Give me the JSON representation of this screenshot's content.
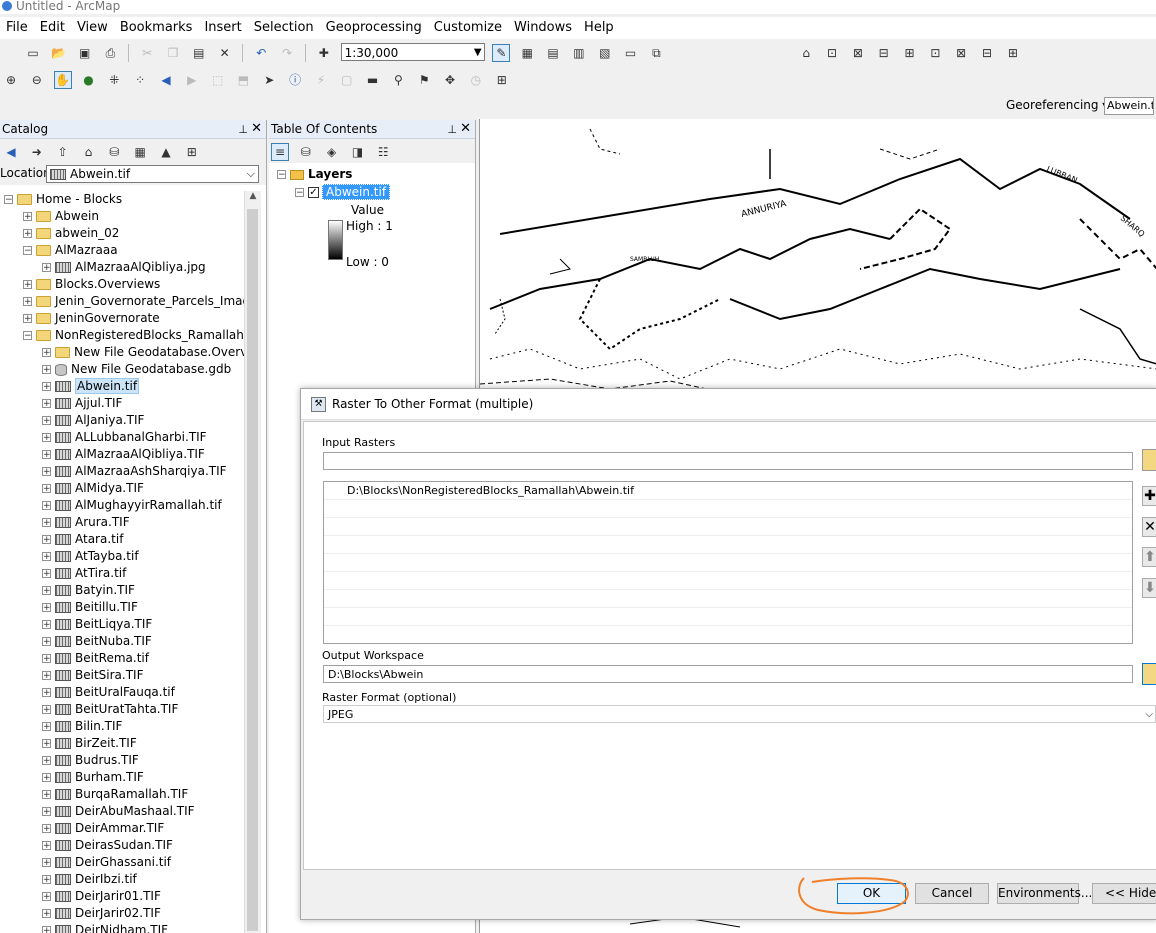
{
  "window": {
    "title": "Untitled - ArcMap"
  },
  "menu": [
    "File",
    "Edit",
    "View",
    "Bookmarks",
    "Insert",
    "Selection",
    "Geoprocessing",
    "Customize",
    "Windows",
    "Help"
  ],
  "toolbar": {
    "scale": "1:30,000"
  },
  "georef": {
    "label": "Georeferencing ▾",
    "layer": "Abwein.tif"
  },
  "catalog": {
    "title": "Catalog",
    "location_label": "Location:",
    "location_value": "Abwein.tif",
    "items": [
      {
        "label": "Home - Blocks",
        "type": "folder",
        "level": 0,
        "exp": "−"
      },
      {
        "label": "Abwein",
        "type": "folder",
        "level": 1,
        "exp": "+"
      },
      {
        "label": "abwein_02",
        "type": "folder",
        "level": 1,
        "exp": "+"
      },
      {
        "label": "AlMazraaa",
        "type": "folder",
        "level": 1,
        "exp": "−"
      },
      {
        "label": "AlMazraaAlQibliya.jpg",
        "type": "raster",
        "level": 2,
        "exp": "+"
      },
      {
        "label": "Blocks.Overviews",
        "type": "folder",
        "level": 1,
        "exp": "+"
      },
      {
        "label": "Jenin_Governorate_Parcels_Images",
        "type": "folder",
        "level": 1,
        "exp": "+"
      },
      {
        "label": "JeninGovernorate",
        "type": "folder",
        "level": 1,
        "exp": "+"
      },
      {
        "label": "NonRegisteredBlocks_Ramallah",
        "type": "folder",
        "level": 1,
        "exp": "−"
      },
      {
        "label": "New File Geodatabase.Overview",
        "type": "folder",
        "level": 2,
        "exp": "+"
      },
      {
        "label": "New File Geodatabase.gdb",
        "type": "gdb",
        "level": 2,
        "exp": "+"
      },
      {
        "label": "Abwein.tif",
        "type": "raster",
        "level": 2,
        "exp": "+",
        "selected": true
      },
      {
        "label": "Ajjul.TIF",
        "type": "raster",
        "level": 2,
        "exp": "+"
      },
      {
        "label": "AlJaniya.TIF",
        "type": "raster",
        "level": 2,
        "exp": "+"
      },
      {
        "label": "ALLubbanalGharbi.TIF",
        "type": "raster",
        "level": 2,
        "exp": "+"
      },
      {
        "label": "AlMazraaAlQibliya.TIF",
        "type": "raster",
        "level": 2,
        "exp": "+"
      },
      {
        "label": "AlMazraaAshSharqiya.TIF",
        "type": "raster",
        "level": 2,
        "exp": "+"
      },
      {
        "label": "AlMidya.TIF",
        "type": "raster",
        "level": 2,
        "exp": "+"
      },
      {
        "label": "AlMughayyirRamallah.tif",
        "type": "raster",
        "level": 2,
        "exp": "+"
      },
      {
        "label": "Arura.TIF",
        "type": "raster",
        "level": 2,
        "exp": "+"
      },
      {
        "label": "Atara.tif",
        "type": "raster",
        "level": 2,
        "exp": "+"
      },
      {
        "label": "AtTayba.tif",
        "type": "raster",
        "level": 2,
        "exp": "+"
      },
      {
        "label": "AtTira.tif",
        "type": "raster",
        "level": 2,
        "exp": "+"
      },
      {
        "label": "Batyin.TIF",
        "type": "raster",
        "level": 2,
        "exp": "+"
      },
      {
        "label": "Beitillu.TIF",
        "type": "raster",
        "level": 2,
        "exp": "+"
      },
      {
        "label": "BeitLiqya.TIF",
        "type": "raster",
        "level": 2,
        "exp": "+"
      },
      {
        "label": "BeitNuba.TIF",
        "type": "raster",
        "level": 2,
        "exp": "+"
      },
      {
        "label": "BeitRema.tif",
        "type": "raster",
        "level": 2,
        "exp": "+"
      },
      {
        "label": "BeitSira.TIF",
        "type": "raster",
        "level": 2,
        "exp": "+"
      },
      {
        "label": "BeitUralFauqa.tif",
        "type": "raster",
        "level": 2,
        "exp": "+"
      },
      {
        "label": "BeitUratTahta.TIF",
        "type": "raster",
        "level": 2,
        "exp": "+"
      },
      {
        "label": "Bilin.TIF",
        "type": "raster",
        "level": 2,
        "exp": "+"
      },
      {
        "label": "BirZeit.TIF",
        "type": "raster",
        "level": 2,
        "exp": "+"
      },
      {
        "label": "Budrus.TIF",
        "type": "raster",
        "level": 2,
        "exp": "+"
      },
      {
        "label": "Burham.TIF",
        "type": "raster",
        "level": 2,
        "exp": "+"
      },
      {
        "label": "BurqaRamallah.TIF",
        "type": "raster",
        "level": 2,
        "exp": "+"
      },
      {
        "label": "DeirAbuMashaal.TIF",
        "type": "raster",
        "level": 2,
        "exp": "+"
      },
      {
        "label": "DeirAmmar.TIF",
        "type": "raster",
        "level": 2,
        "exp": "+"
      },
      {
        "label": "DeirasSudan.TIF",
        "type": "raster",
        "level": 2,
        "exp": "+"
      },
      {
        "label": "DeirGhassani.tif",
        "type": "raster",
        "level": 2,
        "exp": "+"
      },
      {
        "label": "DeirIbzi.tif",
        "type": "raster",
        "level": 2,
        "exp": "+"
      },
      {
        "label": "DeirJarir01.TIF",
        "type": "raster",
        "level": 2,
        "exp": "+"
      },
      {
        "label": "DeirJarir02.TIF",
        "type": "raster",
        "level": 2,
        "exp": "+"
      },
      {
        "label": "DeirNidham.TIF",
        "type": "raster",
        "level": 2,
        "exp": "+"
      }
    ]
  },
  "toc": {
    "title": "Table Of Contents",
    "layers_label": "Layers",
    "layer_name": "Abwein.tif",
    "value_label": "Value",
    "high_label": "High : 1",
    "low_label": "Low : 0"
  },
  "map_labels": [
    "ANNURIYA",
    "LUBBAN",
    "SHARQ",
    "SAMBLUH"
  ],
  "dialog": {
    "title": "Raster To Other Format (multiple)",
    "input_rasters_label": "Input Rasters",
    "input_rasters_value": "",
    "raster_list": [
      "D:\\Blocks\\NonRegisteredBlocks_Ramallah\\Abwein.tif"
    ],
    "output_workspace_label": "Output Workspace",
    "output_workspace_value": "D:\\Blocks\\Abwein",
    "raster_format_label": "Raster Format (optional)",
    "raster_format_value": "JPEG",
    "ok_label": "OK",
    "cancel_label": "Cancel",
    "environments_label": "Environments...",
    "hide_help_label": "<< Hide H"
  },
  "colors": {
    "selection": "#3399ff",
    "annotation": "#f07f2a"
  }
}
